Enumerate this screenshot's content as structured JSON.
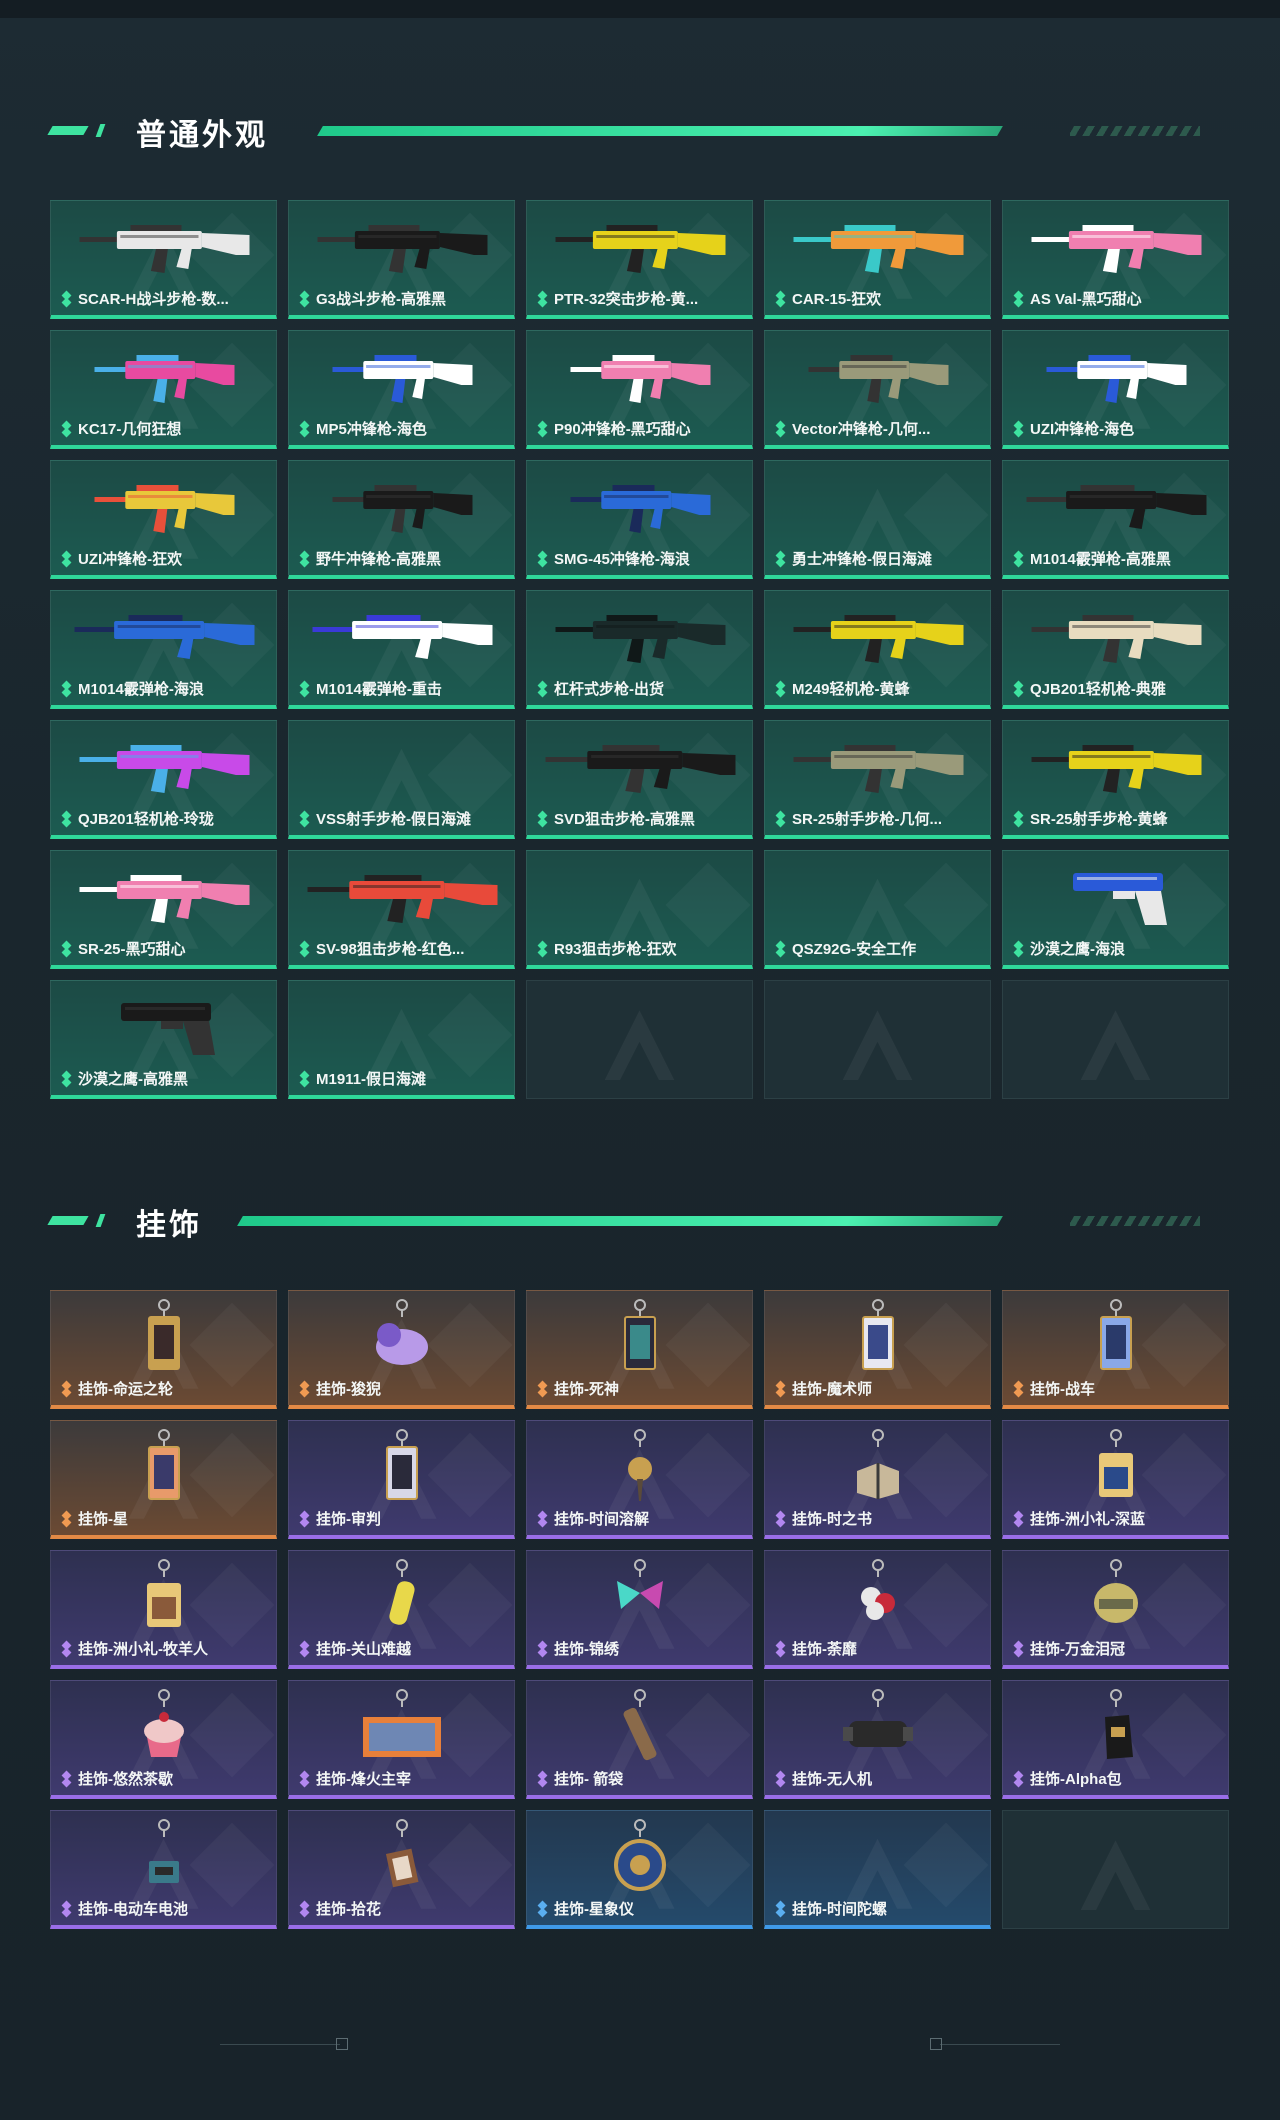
{
  "sections": {
    "skins": {
      "title": "普通外观"
    },
    "charms": {
      "title": "挂饰"
    }
  },
  "colors": {
    "accent_green": "#3ee3a0",
    "orange": "#e38a45",
    "purple": "#9a6ee8",
    "blue": "#3f9ae8"
  },
  "skins": [
    {
      "label": "SCAR-H战斗步枪-数...",
      "rarity": "green",
      "palette": [
        "#e8e8e8",
        "#333333"
      ],
      "icon": "rifle-icon"
    },
    {
      "label": "G3战斗步枪-高雅黑",
      "rarity": "green",
      "palette": [
        "#1a1a1a",
        "#333333"
      ],
      "icon": "rifle-icon"
    },
    {
      "label": "PTR-32突击步枪-黄...",
      "rarity": "green",
      "palette": [
        "#e6d21a",
        "#222222"
      ],
      "icon": "rifle-icon"
    },
    {
      "label": "CAR-15-狂欢",
      "rarity": "green",
      "palette": [
        "#f09a3a",
        "#3ac9c9"
      ],
      "icon": "rifle-icon"
    },
    {
      "label": "AS Val-黑巧甜心",
      "rarity": "green",
      "palette": [
        "#f07fb0",
        "#ffffff"
      ],
      "icon": "rifle-icon"
    },
    {
      "label": "KC17-几何狂想",
      "rarity": "green",
      "palette": [
        "#e84aa0",
        "#4ab0e8"
      ],
      "icon": "smg-icon"
    },
    {
      "label": "MP5冲锋枪-海色",
      "rarity": "green",
      "palette": [
        "#ffffff",
        "#2a5ad8"
      ],
      "icon": "smg-icon"
    },
    {
      "label": "P90冲锋枪-黑巧甜心",
      "rarity": "green",
      "palette": [
        "#f07fb0",
        "#ffffff"
      ],
      "icon": "smg-icon"
    },
    {
      "label": "Vector冲锋枪-几何...",
      "rarity": "green",
      "palette": [
        "#9a9a7a",
        "#333333"
      ],
      "icon": "smg-icon"
    },
    {
      "label": "UZI冲锋枪-海色",
      "rarity": "green",
      "palette": [
        "#ffffff",
        "#2a5ad8"
      ],
      "icon": "smg-icon"
    },
    {
      "label": "UZI冲锋枪-狂欢",
      "rarity": "green",
      "palette": [
        "#e8c83a",
        "#e8503a"
      ],
      "icon": "smg-icon"
    },
    {
      "label": "野牛冲锋枪-高雅黑",
      "rarity": "green",
      "palette": [
        "#1a1a1a",
        "#333333"
      ],
      "icon": "smg-icon"
    },
    {
      "label": "SMG-45冲锋枪-海浪",
      "rarity": "green",
      "palette": [
        "#2a6ad8",
        "#1a2a5a"
      ],
      "icon": "smg-icon"
    },
    {
      "label": "勇士冲锋枪-假日海滩",
      "rarity": "green",
      "palette": [],
      "icon": ""
    },
    {
      "label": "M1014霰弹枪-高雅黑",
      "rarity": "green",
      "palette": [
        "#1a1a1a",
        "#333333"
      ],
      "icon": "shotgun-icon"
    },
    {
      "label": "M1014霰弹枪-海浪",
      "rarity": "green",
      "palette": [
        "#2a6ad8",
        "#1a2a5a"
      ],
      "icon": "shotgun-icon"
    },
    {
      "label": "M1014霰弹枪-重击",
      "rarity": "green",
      "palette": [
        "#ffffff",
        "#3a3ad8"
      ],
      "icon": "shotgun-icon"
    },
    {
      "label": "杠杆式步枪-出货",
      "rarity": "green",
      "palette": [
        "#1a2a2a",
        "#101818"
      ],
      "icon": "rifle-icon"
    },
    {
      "label": "M249轻机枪-黄蜂",
      "rarity": "green",
      "palette": [
        "#e6d21a",
        "#222222"
      ],
      "icon": "lmg-icon"
    },
    {
      "label": "QJB201轻机枪-典雅",
      "rarity": "green",
      "palette": [
        "#e8dcc0",
        "#333333"
      ],
      "icon": "lmg-icon"
    },
    {
      "label": "QJB201轻机枪-玲珑",
      "rarity": "green",
      "palette": [
        "#c84ae8",
        "#4ab0e8"
      ],
      "icon": "lmg-icon"
    },
    {
      "label": "VSS射手步枪-假日海滩",
      "rarity": "green",
      "palette": [],
      "icon": ""
    },
    {
      "label": "SVD狙击步枪-高雅黑",
      "rarity": "green",
      "palette": [
        "#1a1a1a",
        "#333333"
      ],
      "icon": "sniper-icon"
    },
    {
      "label": "SR-25射手步枪-几何...",
      "rarity": "green",
      "palette": [
        "#9a9a7a",
        "#333333"
      ],
      "icon": "rifle-icon"
    },
    {
      "label": "SR-25射手步枪-黄蜂",
      "rarity": "green",
      "palette": [
        "#e6d21a",
        "#222222"
      ],
      "icon": "rifle-icon"
    },
    {
      "label": "SR-25-黑巧甜心",
      "rarity": "green",
      "palette": [
        "#f07fb0",
        "#ffffff"
      ],
      "icon": "rifle-icon"
    },
    {
      "label": "SV-98狙击步枪-红色...",
      "rarity": "green",
      "palette": [
        "#e84a3a",
        "#222222"
      ],
      "icon": "sniper-icon"
    },
    {
      "label": "R93狙击步枪-狂欢",
      "rarity": "green",
      "palette": [],
      "icon": ""
    },
    {
      "label": "QSZ92G-安全工作",
      "rarity": "green",
      "palette": [],
      "icon": ""
    },
    {
      "label": "沙漠之鹰-海浪",
      "rarity": "green",
      "palette": [
        "#2a5ad8",
        "#e8e8e8"
      ],
      "icon": "pistol-icon"
    },
    {
      "label": "沙漠之鹰-高雅黑",
      "rarity": "green",
      "palette": [
        "#1a1a1a",
        "#333333"
      ],
      "icon": "pistol-icon"
    },
    {
      "label": "M1911-假日海滩",
      "rarity": "green",
      "palette": [],
      "icon": ""
    },
    {
      "label": "",
      "rarity": "empty",
      "palette": [],
      "icon": ""
    },
    {
      "label": "",
      "rarity": "empty",
      "palette": [],
      "icon": ""
    },
    {
      "label": "",
      "rarity": "empty",
      "palette": [],
      "icon": ""
    }
  ],
  "charms": [
    {
      "label": "挂饰-命运之轮",
      "rarity": "orange",
      "palette": [
        "#c8a050",
        "#3a2a2a"
      ],
      "icon": "tarot-card-icon"
    },
    {
      "label": "挂饰-狻猊",
      "rarity": "orange",
      "palette": [
        "#b89ae8",
        "#7a5ac8"
      ],
      "icon": "lion-figure-icon"
    },
    {
      "label": "挂饰-死神",
      "rarity": "orange",
      "palette": [
        "#2a2a3a",
        "#3a8a8a"
      ],
      "icon": "tarot-card-icon"
    },
    {
      "label": "挂饰-魔术师",
      "rarity": "orange",
      "palette": [
        "#e8e8f0",
        "#3a4a8a"
      ],
      "icon": "tarot-card-icon"
    },
    {
      "label": "挂饰-战车",
      "rarity": "orange",
      "palette": [
        "#8aa8e8",
        "#2a3a6a"
      ],
      "icon": "tarot-card-icon"
    },
    {
      "label": "挂饰-星",
      "rarity": "orange",
      "palette": [
        "#e89a6a",
        "#3a3a6a"
      ],
      "icon": "tarot-card-icon"
    },
    {
      "label": "挂饰-审判",
      "rarity": "purple",
      "palette": [
        "#d8d8e8",
        "#2a2a3a"
      ],
      "icon": "tarot-card-icon"
    },
    {
      "label": "挂饰-时间溶解",
      "rarity": "purple",
      "palette": [
        "#c8a050",
        "#5a4a3a"
      ],
      "icon": "clock-charm-icon"
    },
    {
      "label": "挂饰-时之书",
      "rarity": "purple",
      "palette": [
        "#c8b89a",
        "#3a3a3a"
      ],
      "icon": "book-charm-icon"
    },
    {
      "label": "挂饰-洲小礼-深蓝",
      "rarity": "purple",
      "palette": [
        "#e8c878",
        "#2a4a8a"
      ],
      "icon": "gift-box-icon"
    },
    {
      "label": "挂饰-洲小礼-牧羊人",
      "rarity": "purple",
      "palette": [
        "#e8c878",
        "#8a5a3a"
      ],
      "icon": "gift-box-icon"
    },
    {
      "label": "挂饰-关山难越",
      "rarity": "purple",
      "palette": [
        "#e8d84a",
        "#8a7a2a"
      ],
      "icon": "capsule-icon"
    },
    {
      "label": "挂饰-锦绣",
      "rarity": "purple",
      "palette": [
        "#4ad8c8",
        "#c84ab0"
      ],
      "icon": "butterfly-icon"
    },
    {
      "label": "挂饰-荼靡",
      "rarity": "purple",
      "palette": [
        "#e8e8e8",
        "#c82a3a"
      ],
      "icon": "flower-icon"
    },
    {
      "label": "挂饰-万金泪冠",
      "rarity": "purple",
      "palette": [
        "#c8b86a",
        "#6a6a4a"
      ],
      "icon": "crown-charm-icon"
    },
    {
      "label": "挂饰-悠然茶歇",
      "rarity": "purple",
      "palette": [
        "#f0c8c8",
        "#e86a8a"
      ],
      "icon": "cupcake-icon"
    },
    {
      "label": "挂饰-烽火主宰",
      "rarity": "purple",
      "palette": [
        "#e8803a",
        "#3a8ae8"
      ],
      "icon": "banner-icon"
    },
    {
      "label": "挂饰- 箭袋",
      "rarity": "purple",
      "palette": [
        "#8a6a4a",
        "#3a2a2a"
      ],
      "icon": "quiver-icon"
    },
    {
      "label": "挂饰-无人机",
      "rarity": "purple",
      "palette": [
        "#2a2a2a",
        "#4a4a4a"
      ],
      "icon": "drone-icon"
    },
    {
      "label": "挂饰-Alpha包",
      "rarity": "purple",
      "palette": [
        "#1a1a1a",
        "#c8a050"
      ],
      "icon": "bag-icon"
    },
    {
      "label": "挂饰-电动车电池",
      "rarity": "purple",
      "palette": [
        "#3a7a8a",
        "#2a2a2a"
      ],
      "icon": "battery-icon"
    },
    {
      "label": "挂饰-拾花",
      "rarity": "purple",
      "palette": [
        "#8a5a3a",
        "#e8d8c8"
      ],
      "icon": "frame-charm-icon"
    },
    {
      "label": "挂饰-星象仪",
      "rarity": "blue",
      "palette": [
        "#c8a050",
        "#2a4a8a"
      ],
      "icon": "astrolabe-icon"
    },
    {
      "label": "挂饰-时间陀螺",
      "rarity": "blue",
      "palette": [],
      "icon": ""
    },
    {
      "label": "",
      "rarity": "empty",
      "palette": [],
      "icon": ""
    }
  ]
}
